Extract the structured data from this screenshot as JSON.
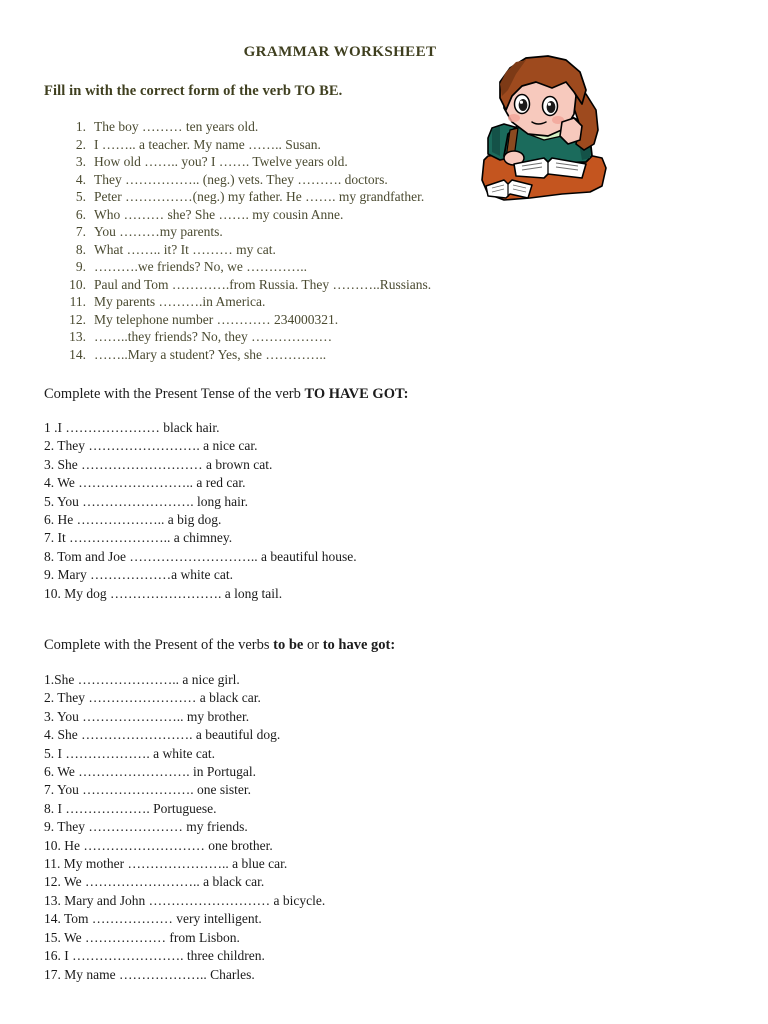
{
  "document": {
    "title": "GRAMMAR WORKSHEET"
  },
  "section1": {
    "heading": "Fill in with the correct form of the verb TO BE.",
    "items": [
      {
        "num": "1.",
        "text": "The boy ……… ten years old."
      },
      {
        "num": "2.",
        "text": "I …….. a teacher. My name …….. Susan."
      },
      {
        "num": "3.",
        "text": "How old …….. you? I ……. Twelve years old."
      },
      {
        "num": "4.",
        "text": "They …………….. (neg.) vets. They ………. doctors."
      },
      {
        "num": "5.",
        "text": "Peter ……………(neg.) my father. He ……. my grandfather."
      },
      {
        "num": "6.",
        "text": "Who ……… she? She ……. my cousin Anne."
      },
      {
        "num": "7.",
        "text": "You ………my parents."
      },
      {
        "num": "8.",
        "text": "What …….. it? It ……… my cat."
      },
      {
        "num": "9.",
        "text": "……….we friends? No, we ………….."
      },
      {
        "num": "10.",
        "text": "Paul and Tom ………….from Russia. They ………..Russians."
      },
      {
        "num": "11.",
        "text": "My parents ……….in America."
      },
      {
        "num": "12.",
        "text": "My telephone number ………… 234000321."
      },
      {
        "num": "13.",
        "text": "……..they friends? No, they ………………"
      },
      {
        "num": "14.",
        "text": "……..Mary a student? Yes, she ………….."
      }
    ]
  },
  "section2": {
    "heading_plain": "Complete with the Present Tense of the verb ",
    "heading_bold": "TO HAVE GOT:",
    "items": [
      "1 .I ………………… black hair.",
      "2. They ……………………. a nice car.",
      "3. She ……………………… a brown cat.",
      "4. We …………………….. a red car.",
      "5. You ……………………. long hair.",
      "6. He ……………….. a big dog.",
      "7. It ………………….. a  chimney.",
      "8. Tom and Joe ……………………….. a beautiful house.",
      "9. Mary ………………a white cat.",
      "10. My dog ……………………. a long tail."
    ]
  },
  "section3": {
    "heading_plain_1": "Complete with  the Present of the verbs ",
    "heading_bold_1": "to be",
    "heading_plain_2": " or ",
    "heading_bold_2": "to have got:",
    "items": [
      "1.She ………………….. a nice girl.",
      "2. They …………………… a black car.",
      "3. You ………………….. my brother.",
      "4. She ……………………. a beautiful dog.",
      "5. I ………………. a white cat.",
      "6. We ……………………. in Portugal.",
      "7. You ……………………. one sister.",
      "8. I ………………. Portuguese.",
      "9. They ………………… my friends.",
      "10. He ……………………… one brother.",
      "11. My mother ………………….. a blue car.",
      "12. We …………………….. a black car.",
      "13. Mary and John ……………………… a bicycle.",
      "14. Tom ……………… very intelligent.",
      "15. We ……………… from Lisbon.",
      "16. I ……………………. three children.",
      "17. My name ……………….. Charles."
    ]
  },
  "illustration": {
    "name": "student-girl-reading-clipart",
    "colors": {
      "hair": "#9e4a1e",
      "hair_shadow": "#7d3a16",
      "skin": "#f7c9bd",
      "sweater": "#1b6b5c",
      "sweater_shadow": "#145248",
      "collar": "#d5f2c4",
      "desk": "#c4551f",
      "book": "#ffffff",
      "outline": "#000000"
    }
  },
  "theme": {
    "title_color": "#3f3f1f",
    "heading1_color": "#3f3f1f",
    "list1_color": "#4a4a30",
    "body_color": "#1a1a1a",
    "background": "#ffffff"
  }
}
